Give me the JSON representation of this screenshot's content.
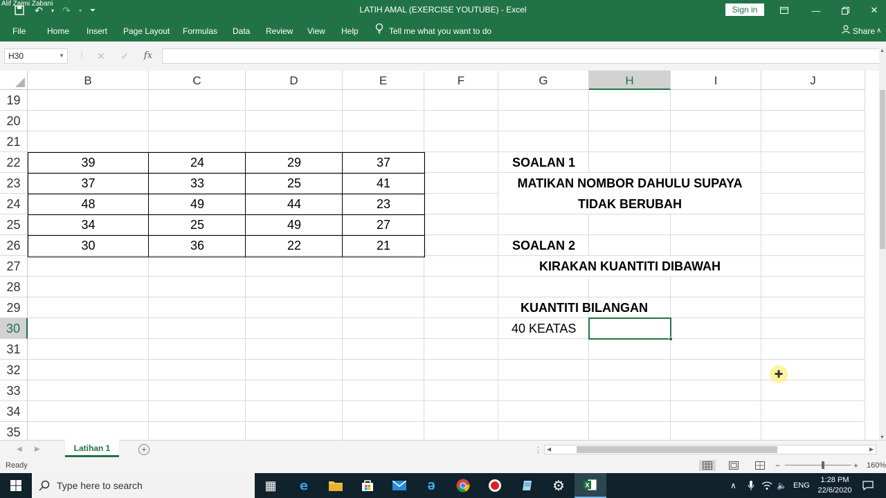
{
  "titlebar": {
    "watermark": "Alif Zaimi Zabani",
    "title": "LATIH AMAL (EXERCISE YOUTUBE)  -  Excel",
    "signin": "Sign in"
  },
  "ribbon": {
    "tabs": [
      "File",
      "Home",
      "Insert",
      "Page Layout",
      "Formulas",
      "Data",
      "Review",
      "View",
      "Help"
    ],
    "tell_me": "Tell me what you want to do",
    "share": "Share"
  },
  "formula_bar": {
    "name_box": "H30",
    "formula": "",
    "fx": "fx"
  },
  "columns": [
    "B",
    "C",
    "D",
    "E",
    "F",
    "G",
    "H",
    "I",
    "J"
  ],
  "selected_column": "H",
  "rows": [
    "19",
    "20",
    "21",
    "22",
    "23",
    "24",
    "25",
    "26",
    "27",
    "28",
    "29",
    "30",
    "31",
    "32",
    "33",
    "34",
    "35"
  ],
  "selected_row": "30",
  "table": [
    [
      "39",
      "24",
      "29",
      "37"
    ],
    [
      "37",
      "33",
      "25",
      "41"
    ],
    [
      "48",
      "49",
      "44",
      "23"
    ],
    [
      "34",
      "25",
      "49",
      "27"
    ],
    [
      "30",
      "36",
      "22",
      "21"
    ]
  ],
  "notes": {
    "soalan1": "SOALAN 1",
    "soalan1_line1": "MATIKAN NOMBOR DAHULU SUPAYA",
    "soalan1_line2": "TIDAK BERUBAH",
    "soalan2": "SOALAN 2",
    "soalan2_line1": "KIRAKAN KUANTITI DIBAWAH",
    "kuantiti": "KUANTITI BILANGAN",
    "keatas": "40 KEATAS"
  },
  "active_cell": "H30",
  "sheet_tab": "Latihan 1",
  "status": {
    "ready": "Ready",
    "zoom": "160%"
  },
  "taskbar": {
    "search_placeholder": "Type here to search",
    "lang": "ENG",
    "time": "1:28 PM",
    "date": "22/6/2020"
  }
}
